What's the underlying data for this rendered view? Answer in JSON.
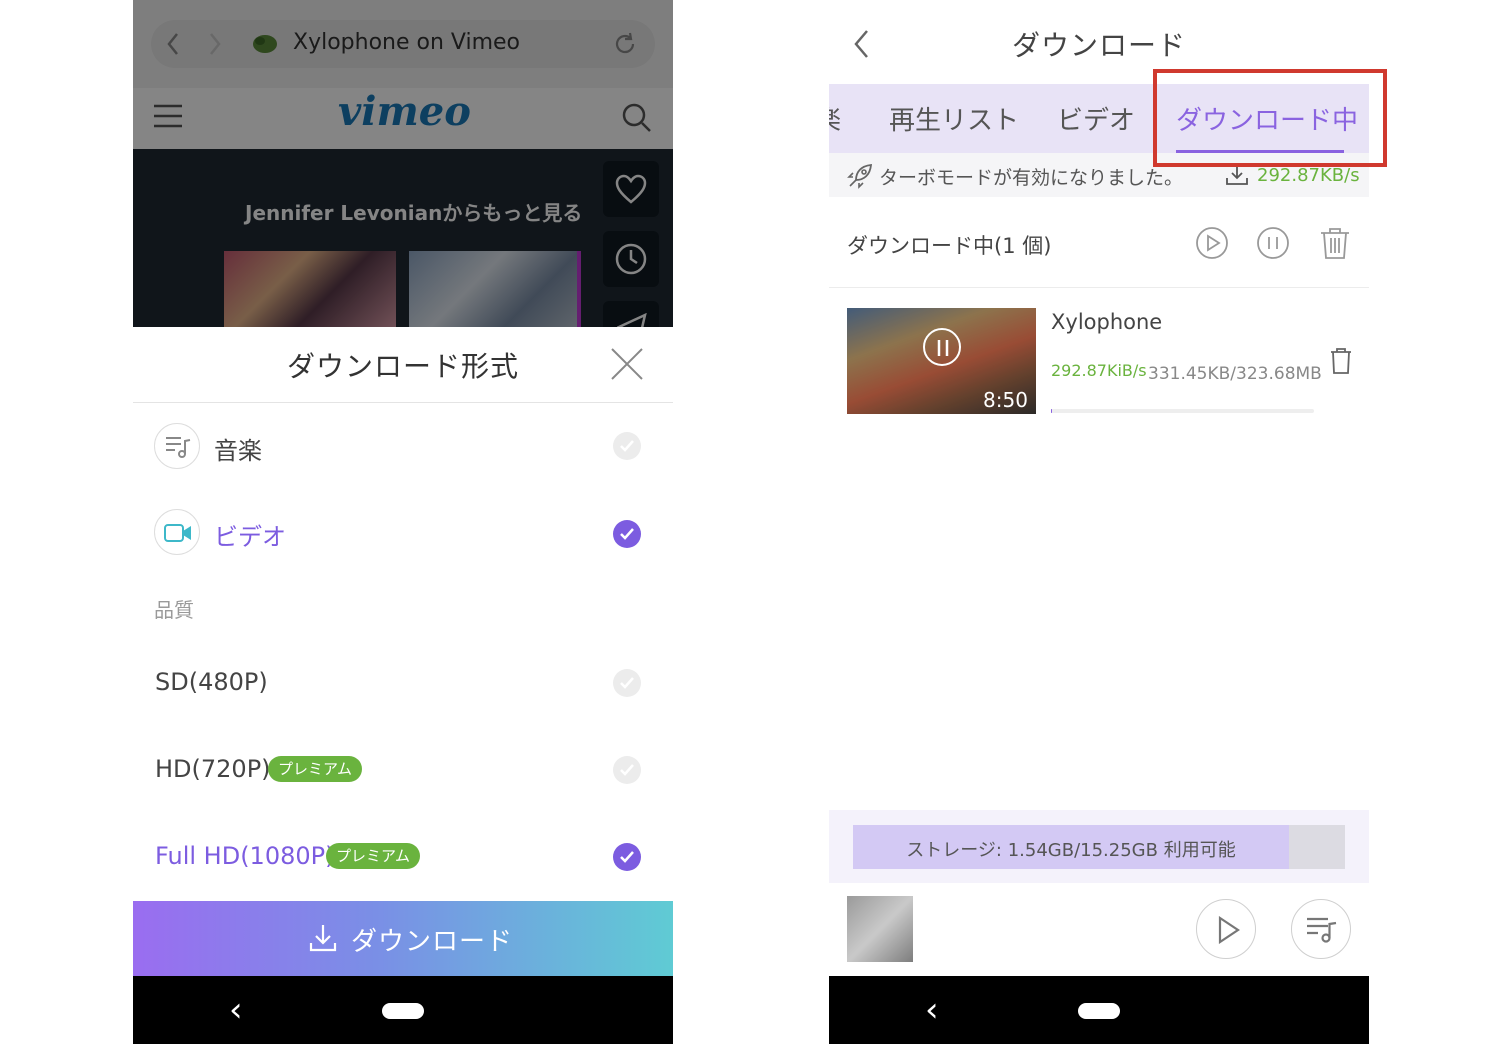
{
  "left_phone": {
    "browser": {
      "url_title": "Xylophone on Vimeo",
      "logo": "vimeo"
    },
    "video_overlay_text": "Jennifer Levonianからもっと見る",
    "sheet": {
      "title": "ダウンロード形式",
      "options": [
        {
          "label": "音楽",
          "icon": "music-list-icon",
          "selected": false
        },
        {
          "label": "ビデオ",
          "icon": "video-camera-icon",
          "selected": true
        }
      ],
      "quality_heading": "品質",
      "qualities": [
        {
          "label": "SD(480P)",
          "badge": "",
          "selected": false
        },
        {
          "label": "HD(720P)",
          "badge": "プレミアム",
          "selected": false
        },
        {
          "label": "Full HD(1080P)",
          "badge": "プレミアム",
          "selected": true
        }
      ],
      "download_button": "ダウンロード"
    },
    "nav_back": "‹"
  },
  "right_phone": {
    "title": "ダウンロード",
    "tabs": [
      {
        "label": "楽",
        "active": false
      },
      {
        "label": "再生リスト",
        "active": false
      },
      {
        "label": "ビデオ",
        "active": false
      },
      {
        "label": "ダウンロード中",
        "active": true
      }
    ],
    "turbo_message": "ターボモードが有効になりました。",
    "turbo_speed": "292.87KB/s",
    "section_heading": "ダウンロード中(1 個)",
    "item": {
      "title": "Xylophone",
      "duration": "8:50",
      "speed": "292.87KiB/s",
      "size": "331.45KB/323.68MB",
      "progress_fraction": 0.001
    },
    "storage": {
      "text": "ストレージ: 1.54GB/15.25GB 利用可能",
      "used_fraction": 0.886
    },
    "nav_back": "‹"
  },
  "colors": {
    "accent_purple": "#8a63e0",
    "green": "#6ab33e",
    "highlight_red": "#d0392e"
  }
}
